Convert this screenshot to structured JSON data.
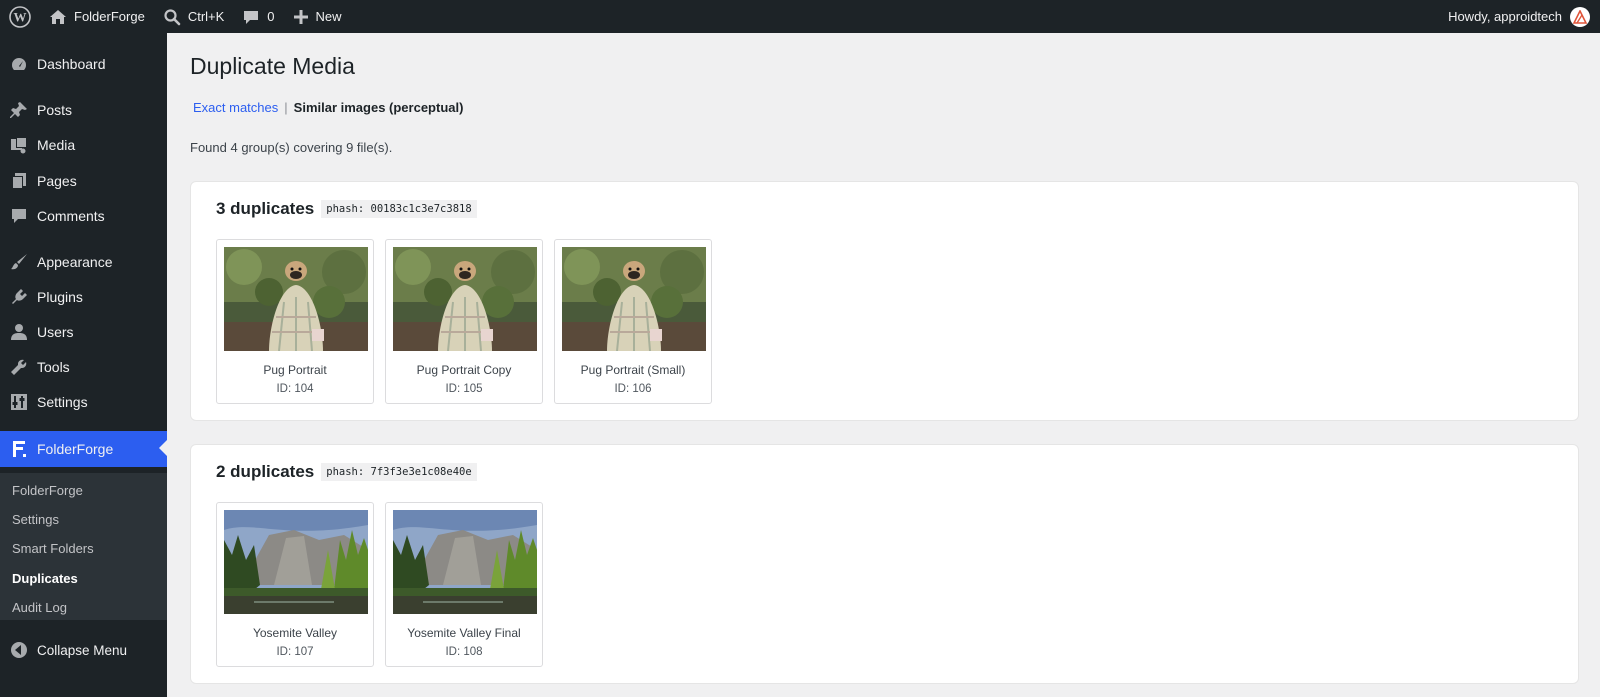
{
  "adminbar": {
    "site_name": "FolderForge",
    "search_shortcut": "Ctrl+K",
    "comments_count": "0",
    "new_label": "New",
    "greeting": "Howdy, approidtech"
  },
  "sidebar": {
    "items": [
      {
        "label": "Dashboard",
        "icon": "dashboard-icon"
      },
      {
        "label": "Posts",
        "icon": "pin-icon"
      },
      {
        "label": "Media",
        "icon": "media-icon"
      },
      {
        "label": "Pages",
        "icon": "pages-icon"
      },
      {
        "label": "Comments",
        "icon": "comment-icon"
      },
      {
        "label": "Appearance",
        "icon": "brush-icon"
      },
      {
        "label": "Plugins",
        "icon": "plug-icon"
      },
      {
        "label": "Users",
        "icon": "user-icon"
      },
      {
        "label": "Tools",
        "icon": "wrench-icon"
      },
      {
        "label": "Settings",
        "icon": "sliders-icon"
      },
      {
        "label": "FolderForge",
        "icon": "folderforge-f-icon"
      }
    ],
    "submenu": [
      "FolderForge",
      "Settings",
      "Smart Folders",
      "Duplicates",
      "Audit Log"
    ],
    "collapse_label": "Collapse Menu"
  },
  "colors": {
    "accent": "#2c5ef0",
    "sidebar_bg": "#1d2327",
    "submenu_bg": "#2c3338"
  },
  "page": {
    "title": "Duplicate Media",
    "tab_exact": "Exact matches",
    "tab_separator": "|",
    "tab_similar": "Similar images (perceptual)",
    "summary": "Found 4 group(s) covering 9 file(s)."
  },
  "groups": [
    {
      "title": "3 duplicates",
      "phash": "phash: 00183c1c3e7c3818",
      "items": [
        {
          "name": "Pug Portrait",
          "id": "ID: 104"
        },
        {
          "name": "Pug Portrait Copy",
          "id": "ID: 105"
        },
        {
          "name": "Pug Portrait (Small)",
          "id": "ID: 106"
        }
      ]
    },
    {
      "title": "2 duplicates",
      "phash": "phash: 7f3f3e3e1c08e40e",
      "items": [
        {
          "name": "Yosemite Valley",
          "id": "ID: 107"
        },
        {
          "name": "Yosemite Valley Final",
          "id": "ID: 108"
        }
      ]
    }
  ]
}
